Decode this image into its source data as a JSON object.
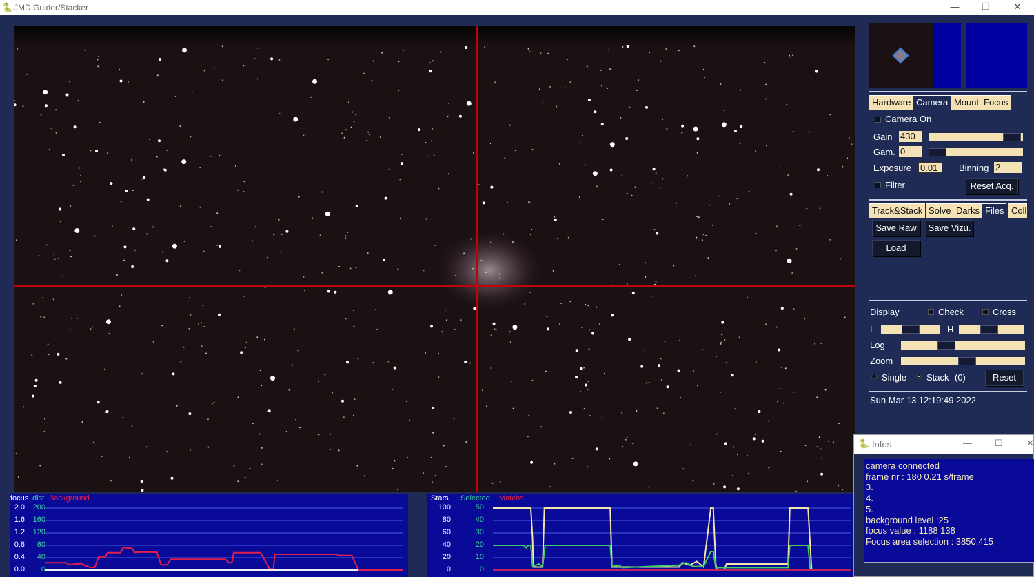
{
  "window": {
    "title": "JMD Guider/Stacker",
    "controls": [
      "—",
      "❐",
      "✕"
    ]
  },
  "colors": {
    "accent_red": "#c0000a",
    "chart_bg": "#0a0a98",
    "panel_bg": "#1f2b55",
    "control_bg": "#f4e1b4"
  },
  "hardware_tabs": [
    {
      "label": "Hardware"
    },
    {
      "label": "Camera",
      "selected": true
    },
    {
      "label": "Mount"
    },
    {
      "label": "Focus"
    }
  ],
  "camera": {
    "camera_on_label": "Camera On",
    "camera_on": false,
    "gain_label": "Gain",
    "gain_value": "430",
    "gain_slider": 0.9,
    "gam_label": "Gam.",
    "gam_value": "0",
    "gam_slider": 0.05,
    "exposure_label": "Exposure",
    "exposure_value": "0.01",
    "binning_label": "Binning",
    "binning_value": "2",
    "filter_label": "Filter",
    "filter": false,
    "reset_label": "Reset Acq."
  },
  "process_tabs": [
    {
      "label": "Track&Stack"
    },
    {
      "label": "Solve"
    },
    {
      "label": "Darks"
    },
    {
      "label": "Files",
      "selected": true
    },
    {
      "label": "Colli"
    }
  ],
  "files": {
    "save_raw": "Save Raw",
    "save_vizu": "Save Vizu.",
    "load": "Load"
  },
  "display": {
    "label": "Display",
    "check_label": "Check",
    "cross_label": "Cross",
    "l_label": "L",
    "h_label": "H",
    "log_label": "Log",
    "zoom_label": "Zoom",
    "l_value": 0.45,
    "h_value": 0.45,
    "log_value": 0.38,
    "zoom_value": 0.55,
    "single_label": "Single",
    "stack_label": "Stack",
    "stack_count": "(0)",
    "mode": "stack",
    "reset_label": "Reset"
  },
  "datetime": "Sun Mar 13 12:19:49 2022",
  "infos": {
    "title": "Infos",
    "lines": [
      "camera connected",
      "frame nr : 180   0.21  s/frame",
      "3.",
      "4.",
      "5.",
      "background level :25",
      "focus value : 1188 138",
      "Focus area selection : 3850,415"
    ]
  },
  "chart_data": [
    {
      "type": "line",
      "title": "",
      "legend": [
        "focus",
        "dist",
        "Background"
      ],
      "y_focus_ticks": [
        "2.0",
        "1.6",
        "1.2",
        "0.8",
        "0.4",
        "0.0"
      ],
      "y_dist_ticks": [
        "200",
        "160",
        "120",
        "80",
        "40",
        "0"
      ],
      "ylim": [
        0,
        200
      ],
      "xlim": [
        0,
        100
      ],
      "series": [
        {
          "name": "Background",
          "color": "#e0204a",
          "points": [
            [
              0,
              24
            ],
            [
              5.6,
              24
            ],
            [
              6.5,
              18
            ],
            [
              10.2,
              21
            ],
            [
              11.1,
              15
            ],
            [
              12.5,
              9
            ],
            [
              13.8,
              9
            ],
            [
              14.8,
              42
            ],
            [
              16.7,
              42
            ],
            [
              17.3,
              56
            ],
            [
              21,
              56
            ],
            [
              21.7,
              73
            ],
            [
              24.2,
              70
            ],
            [
              24.8,
              57
            ],
            [
              26.6,
              58
            ],
            [
              31.1,
              58
            ],
            [
              32.3,
              17
            ],
            [
              34,
              17
            ],
            [
              35,
              35
            ],
            [
              50.3,
              35
            ],
            [
              51.2,
              24
            ],
            [
              52.1,
              24
            ],
            [
              52.6,
              56
            ],
            [
              60.1,
              56
            ],
            [
              61.8,
              22
            ],
            [
              62.6,
              4
            ],
            [
              63.7,
              4
            ],
            [
              64.1,
              51
            ],
            [
              81.4,
              51
            ],
            [
              82.1,
              47
            ],
            [
              85.6,
              47
            ],
            [
              87.5,
              0
            ],
            [
              100,
              0
            ]
          ]
        },
        {
          "name": "focus",
          "color": "#f0f0f0",
          "points": [
            [
              0,
              0
            ],
            [
              87.5,
              0
            ]
          ]
        }
      ]
    },
    {
      "type": "line",
      "title": "",
      "legend": [
        "Stars",
        "Selected",
        "Matchs"
      ],
      "y_stars_ticks": [
        "100",
        "80",
        "60",
        "40",
        "20",
        "0"
      ],
      "y_selected_ticks": [
        "50",
        "40",
        "30",
        "20",
        "10",
        "0"
      ],
      "ylim": [
        0,
        100
      ],
      "xlim": [
        0,
        100
      ],
      "series": [
        {
          "name": "Stars",
          "color": "#f4e6a8",
          "points": [
            [
              0,
              100
            ],
            [
              10.6,
              100
            ],
            [
              11.1,
              50
            ],
            [
              11.3,
              5
            ],
            [
              13.9,
              5
            ],
            [
              14.4,
              100
            ],
            [
              32.8,
              100
            ],
            [
              33.3,
              5
            ],
            [
              52,
              5
            ],
            [
              53,
              12
            ],
            [
              55,
              8
            ],
            [
              57,
              14
            ],
            [
              58.9,
              5
            ],
            [
              60.9,
              100
            ],
            [
              61.6,
              100
            ],
            [
              62.3,
              10
            ],
            [
              62.6,
              0
            ],
            [
              64.6,
              0
            ],
            [
              65.3,
              10
            ],
            [
              82.5,
              10
            ],
            [
              83,
              100
            ],
            [
              88.1,
              100
            ],
            [
              89.1,
              0
            ],
            [
              100,
              0
            ]
          ]
        },
        {
          "name": "Selected",
          "color": "#3ad060",
          "scale": "x2",
          "points": [
            [
              0,
              20
            ],
            [
              8.6,
              20
            ],
            [
              9.3,
              18
            ],
            [
              9.9,
              20
            ],
            [
              10.6,
              20
            ],
            [
              11.1,
              3
            ],
            [
              12.9,
              5
            ],
            [
              13.9,
              3
            ],
            [
              14.6,
              20
            ],
            [
              32.8,
              20
            ],
            [
              33.3,
              3
            ],
            [
              35.4,
              4
            ],
            [
              36.1,
              2
            ],
            [
              52,
              4
            ],
            [
              54,
              6
            ],
            [
              56,
              3
            ],
            [
              58.9,
              3
            ],
            [
              60.9,
              15
            ],
            [
              61.6,
              15
            ],
            [
              62.3,
              2
            ],
            [
              65.9,
              2
            ],
            [
              82.5,
              2
            ],
            [
              83,
              20
            ],
            [
              88.1,
              20
            ],
            [
              88.7,
              0
            ],
            [
              100,
              0
            ]
          ]
        },
        {
          "name": "Matchs",
          "color": "#c02060",
          "points": [
            [
              0,
              0
            ],
            [
              100,
              0
            ]
          ]
        }
      ]
    }
  ]
}
